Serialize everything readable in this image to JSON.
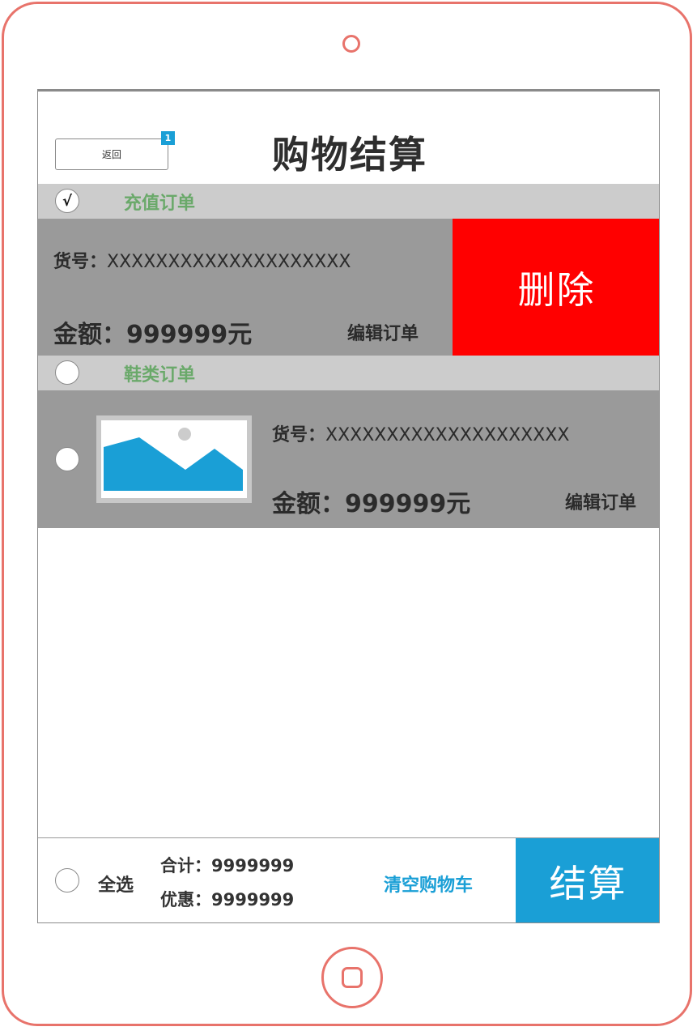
{
  "header": {
    "back_label": "返回",
    "badge_count": "1",
    "title": "购物结算"
  },
  "groups": [
    {
      "label": "充值订单",
      "checked_mark": "√",
      "order": {
        "code_prefix": "货号：",
        "code": "XXXXXXXXXXXXXXXXXXXX",
        "amount_label": "金额：",
        "amount": "999999元",
        "edit_label": "编辑订单",
        "delete_label": "删除"
      }
    },
    {
      "label": "鞋类订单",
      "order": {
        "code_prefix": "货号：",
        "code": "XXXXXXXXXXXXXXXXXXXX",
        "amount_label": "金额：",
        "amount": "999999元",
        "edit_label": "编辑订单",
        "image_icon": "image-placeholder-icon"
      }
    }
  ],
  "footer": {
    "select_all_label": "全选",
    "total_label": "合计：",
    "total_value": "9999999",
    "discount_label": "优惠：",
    "discount_value": "9999999",
    "clear_cart_label": "清空购物车",
    "checkout_label": "结算"
  },
  "colors": {
    "device_frame": "#e8736b",
    "delete_red": "#ff0000",
    "accent_blue": "#1a9fd6",
    "group_label_green": "#6aa96a",
    "row_gray": "#9a9a9a",
    "group_header_gray": "#cccccc"
  }
}
